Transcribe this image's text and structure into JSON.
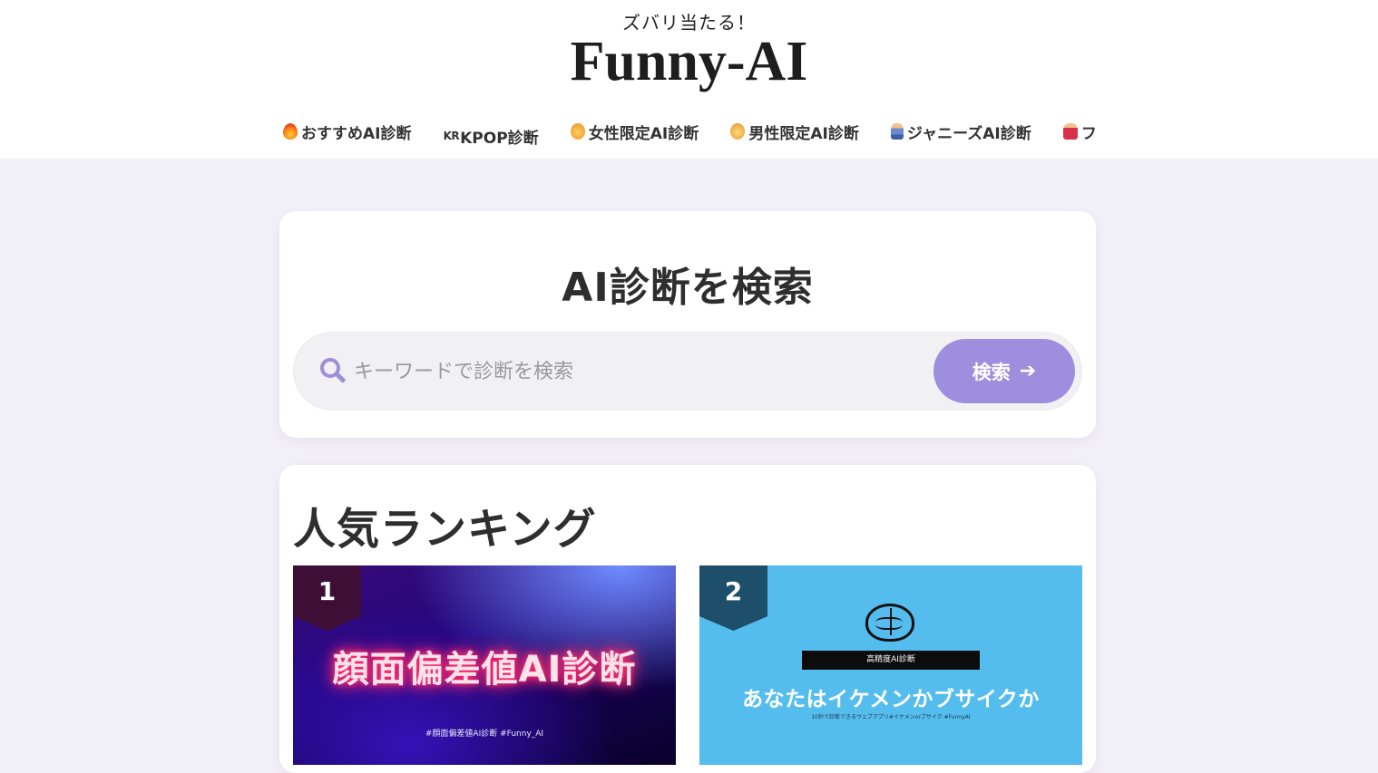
{
  "header": {
    "tagline": "ズバリ当たる！",
    "title": "Funny-AI"
  },
  "nav": {
    "items": [
      {
        "icon": "fire-icon",
        "label": "おすすめAI診断"
      },
      {
        "icon": "kr-flag-icon",
        "icon_text": "KR",
        "label": "KPOP診断"
      },
      {
        "icon": "woman-icon",
        "label": "女性限定AI診断"
      },
      {
        "icon": "man-icon",
        "label": "男性限定AI診断"
      },
      {
        "icon": "man-dancing-icon",
        "label": "ジャニーズAI診断"
      },
      {
        "icon": "woman-dancing-icon",
        "label": "フ"
      }
    ]
  },
  "search": {
    "title": "AI診断を検索",
    "placeholder": "キーワードで診断を検索",
    "button_label": "検索"
  },
  "ranking": {
    "title": "人気ランキング",
    "items": [
      {
        "rank": "1",
        "heading": "顔面偏差値AI診断",
        "tag": "#顔面偏差値AI診断 #Funny_AI"
      },
      {
        "rank": "2",
        "band": "高精度AI診断",
        "heading": "あなたはイケメンかブサイクか",
        "subtitle": "10秒で診断できるウェブアプリ#イケメンorブサイク #FunnyAI"
      }
    ]
  },
  "colors": {
    "accent": "#9d8fdd",
    "page_background": "#f3f1f8",
    "thumb2_background": "#55bdee"
  }
}
